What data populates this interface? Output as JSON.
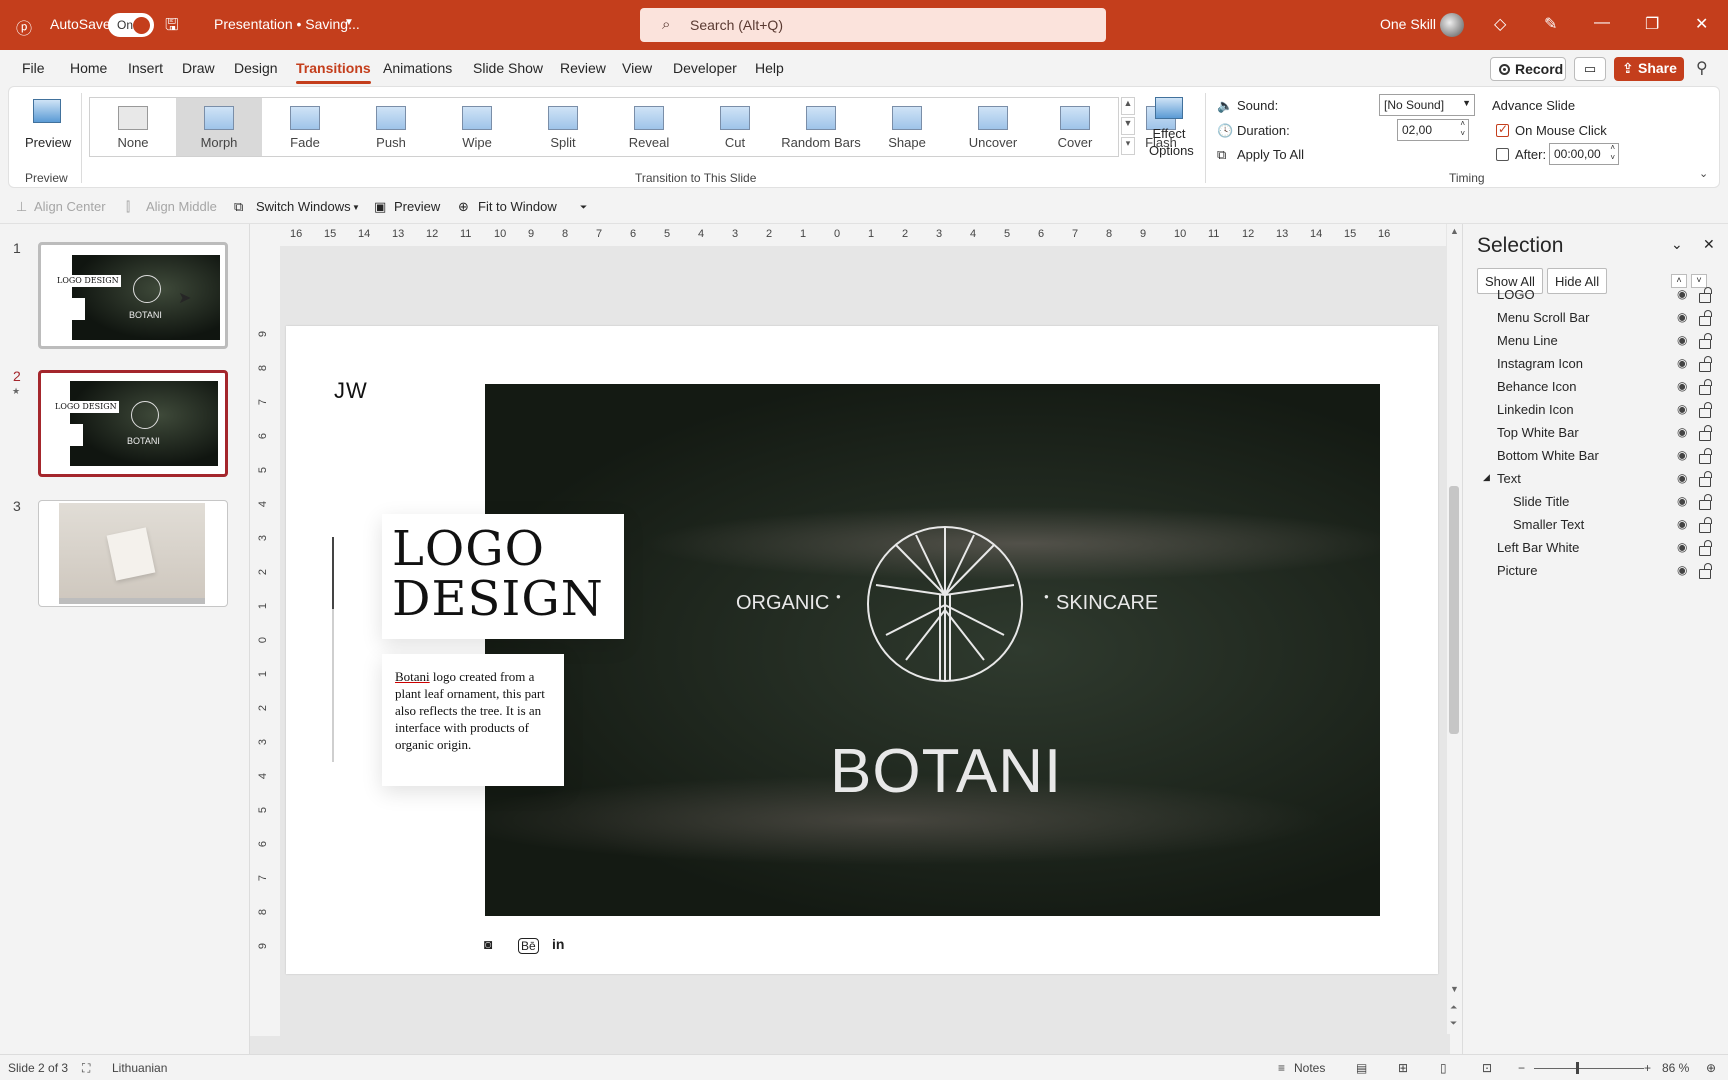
{
  "titlebar": {
    "autosave_label": "AutoSave",
    "autosave_state": "On",
    "doc_title": "Presentation • Saving...",
    "search_placeholder": "Search (Alt+Q)",
    "user_name": "One Skill"
  },
  "menu": [
    "File",
    "Home",
    "Insert",
    "Draw",
    "Design",
    "Transitions",
    "Animations",
    "Slide Show",
    "Review",
    "View",
    "Developer",
    "Help"
  ],
  "menu_active": "Transitions",
  "actions": {
    "record": "Record",
    "share": "Share"
  },
  "ribbon": {
    "preview_label": "Preview",
    "preview_group": "Preview",
    "transitions": [
      "None",
      "Morph",
      "Fade",
      "Push",
      "Wipe",
      "Split",
      "Reveal",
      "Cut",
      "Random Bars",
      "Shape",
      "Uncover",
      "Cover",
      "Flash"
    ],
    "selected_transition": "Morph",
    "effect_options": "Effect Options",
    "transition_group": "Transition to This Slide",
    "sound_label": "Sound:",
    "sound_value": "[No Sound]",
    "duration_label": "Duration:",
    "duration_value": "02,00",
    "apply_all": "Apply To All",
    "advance_slide": "Advance Slide",
    "on_mouse_click": "On Mouse Click",
    "after_label": "After:",
    "after_value": "00:00,00",
    "timing_group": "Timing"
  },
  "qat": {
    "align_center": "Align Center",
    "align_middle": "Align Middle",
    "switch_windows": "Switch Windows",
    "preview": "Preview",
    "fit_to_window": "Fit to Window"
  },
  "slides": [
    {
      "num": "1",
      "mini_title": "LOGO DESIGN",
      "mini_word": "BOTANI"
    },
    {
      "num": "2",
      "mini_title": "LOGO DESIGN",
      "mini_word": "BOTANI"
    },
    {
      "num": "3"
    }
  ],
  "hruler": [
    "16",
    "15",
    "14",
    "13",
    "12",
    "11",
    "10",
    "9",
    "8",
    "7",
    "6",
    "5",
    "4",
    "3",
    "2",
    "1",
    "0",
    "1",
    "2",
    "3",
    "4",
    "5",
    "6",
    "7",
    "8",
    "9",
    "10",
    "11",
    "12",
    "13",
    "14",
    "15",
    "16"
  ],
  "vruler": [
    "9",
    "8",
    "7",
    "6",
    "5",
    "4",
    "3",
    "2",
    "1",
    "0",
    "1",
    "2",
    "3",
    "4",
    "5",
    "6",
    "7",
    "8",
    "9"
  ],
  "slide": {
    "brand": "JW",
    "title_line1": "LOGO",
    "title_line2": "DESIGN",
    "body_link": "Botani",
    "body_rest": " logo created from a plant leaf ornament, this part also reflects the tree. It is an interface with products of organic origin.",
    "left_word": "ORGANIC",
    "right_word": "SKINCARE",
    "brand_word": "BOTANI"
  },
  "selection_pane": {
    "title": "Selection",
    "show_all": "Show All",
    "hide_all": "Hide All",
    "items": [
      "LOGO",
      "Menu Scroll Bar",
      "Menu Line",
      "Instagram Icon",
      "Behance Icon",
      "Linkedin Icon",
      "Top White Bar",
      "Bottom White Bar",
      "Text",
      "Slide Title",
      "Smaller Text",
      "Left Bar White",
      "Picture"
    ]
  },
  "status": {
    "slide_info": "Slide 2 of 3",
    "language": "Lithuanian",
    "notes": "Notes",
    "zoom": "86 %"
  },
  "colors": {
    "accent": "#c43e1c",
    "selected_slide_border": "#a4262c"
  }
}
